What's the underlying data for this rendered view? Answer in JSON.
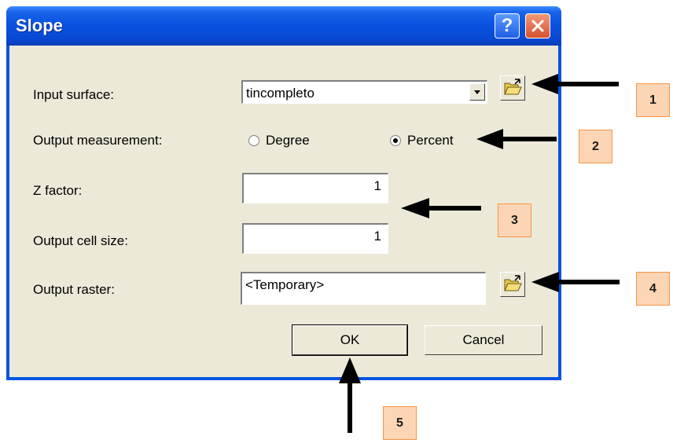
{
  "window": {
    "title": "Slope"
  },
  "form": {
    "input_surface": {
      "label": "Input surface:",
      "value": "tincompleto"
    },
    "output_measurement": {
      "label": "Output measurement:",
      "options": [
        "Degree",
        "Percent"
      ],
      "selected": "Percent"
    },
    "z_factor": {
      "label": "Z factor:",
      "value": "1"
    },
    "output_cell_size": {
      "label": "Output cell size:",
      "value": "1"
    },
    "output_raster": {
      "label": "Output raster:",
      "value": "<Temporary>"
    }
  },
  "buttons": {
    "ok": "OK",
    "cancel": "Cancel"
  },
  "annotations": [
    "1",
    "2",
    "3",
    "4",
    "5"
  ],
  "colors": {
    "titlebar": "#0054e3",
    "dialog_bg": "#ece9d8",
    "callout_fill": "#fcd5b4",
    "callout_border": "#f79646",
    "arrow": "#000000"
  }
}
